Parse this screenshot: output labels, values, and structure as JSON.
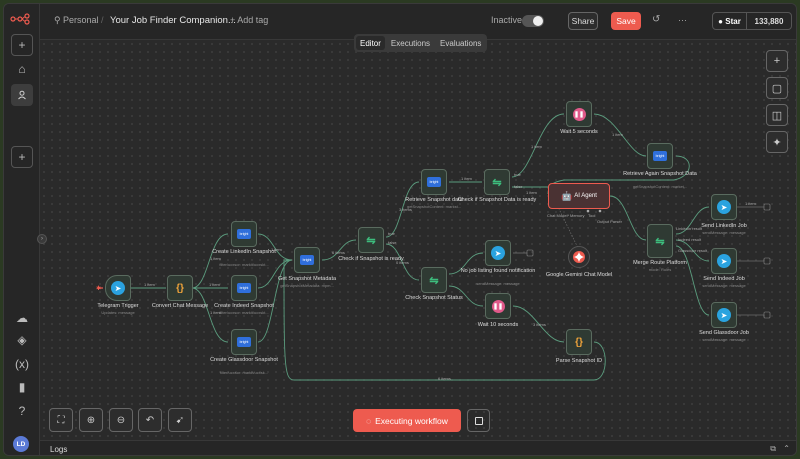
{
  "topbar": {
    "project": "Personal",
    "title": "Your Job Finder Companion...",
    "add_tag": "+ Add tag",
    "status": "Inactive",
    "share": "Share",
    "save": "Save",
    "more": "···",
    "github_star": "Star",
    "github_count": "133,880"
  },
  "tabs": [
    "Editor",
    "Executions",
    "Evaluations"
  ],
  "nodes": {
    "telegram_trigger": {
      "label": "Telegram Trigger",
      "sub": "Updates: message"
    },
    "convert_chat": {
      "label": "Convert Chat Message"
    },
    "create_linkedin": {
      "label": "Create LinkedIn Snapshot",
      "sub": "filter/ucxsor: markit/ucxskt..."
    },
    "create_indeed": {
      "label": "Create Indeed Snapshot",
      "sub": "filter/ucxsor: markit/ucxskt..."
    },
    "create_glassdoor": {
      "label": "Create Glassdoor Snapshot",
      "sub": "filter/ucxsor: markit/ucxsk..."
    },
    "get_metadata": {
      "label": "Get Snapshot Metadata",
      "sub": "getSnapshotMetadata: mpm..."
    },
    "check_ready": {
      "label": "Check if Snapshot is ready"
    },
    "retrieve_data": {
      "label": "Retrieve Snapshot data",
      "sub": "getSnapshotContent: markst..."
    },
    "check_data_ready": {
      "label": "Check if Snapshot Data is ready"
    },
    "wait5": {
      "label": "Wait 5 seconds"
    },
    "retrieve_again": {
      "label": "Retrieve Again Snapshot Data",
      "sub": "getSnapshotContent: market..."
    },
    "ai_agent": {
      "label": "AI Agent",
      "ports": [
        "Chat Model*",
        "Memory",
        "Tool",
        "Output Parser"
      ]
    },
    "gemini": {
      "label": "Google Gemini Chat Model"
    },
    "check_status": {
      "label": "Check Snapshot Status"
    },
    "no_job": {
      "label": "No job listing found notification",
      "sub": "sendMessage: message"
    },
    "wait10": {
      "label": "Wait 10 seconds"
    },
    "parse_id": {
      "label": "Parse Snapshot ID"
    },
    "merge": {
      "label": "Merge Route Platform",
      "sub": "mode: Rules"
    },
    "send_linkedin": {
      "label": "Send LinkedIn Job",
      "sub": "sendMessage: message"
    },
    "send_indeed": {
      "label": "Send Indeed Job",
      "sub": "sendMessage: message"
    },
    "send_glassdoor": {
      "label": "Send Glassdoor Job",
      "sub": "sendMessage: message"
    }
  },
  "edge_labels": {
    "trigger_convert": "1 item",
    "convert_create": "1 item",
    "create_get": "1 item",
    "get_check": "6 items",
    "check_retrieve": "3 items",
    "check_status": "0 items",
    "retrieve_checkdata": "1 item",
    "checkdata_wait": "1 item",
    "checkdata_agent": "1 item",
    "wait_retrieve": "1 item",
    "merge_linkedin": "1 item",
    "wait10_parse": "3 items",
    "parse_loop": "6 items",
    "true": "true",
    "false": "false"
  },
  "merge_outputs": [
    "LinkedIn result",
    "Indeed result",
    "Glassdoor result"
  ],
  "controls": {
    "execute": "Executing workflow",
    "logs": "Logs",
    "user_initials": "LD"
  },
  "colors": {
    "accent": "#ee5b4f",
    "edge": "#5b9c7e",
    "canvas": "#2a2a2a"
  }
}
